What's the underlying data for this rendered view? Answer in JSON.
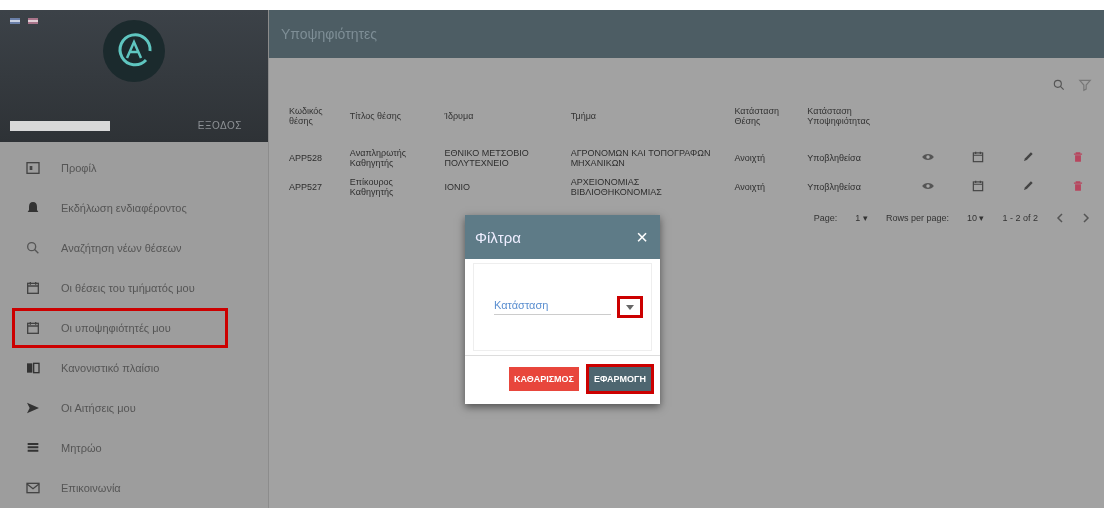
{
  "sidebar": {
    "logout": "ΕΞΟΔΟΣ",
    "items": [
      {
        "label": "Προφίλ",
        "highlighted": false
      },
      {
        "label": "Εκδήλωση ενδιαφέροντος",
        "highlighted": false
      },
      {
        "label": "Αναζήτηση νέων θέσεων",
        "highlighted": false
      },
      {
        "label": "Οι θέσεις του τμήματός μου",
        "highlighted": false
      },
      {
        "label": "Οι υποψηφιότητές μου",
        "highlighted": true
      },
      {
        "label": "Κανονιστικό πλαίσιο",
        "highlighted": false
      },
      {
        "label": "Οι Αιτήσεις μου",
        "highlighted": false
      },
      {
        "label": "Μητρώο",
        "highlighted": false
      },
      {
        "label": "Επικοινωνία",
        "highlighted": false
      }
    ]
  },
  "header": {
    "title": "Υποψηφιότητες"
  },
  "table": {
    "columns": [
      "Κωδικός θέσης",
      "Τίτλος θέσης",
      "Ίδρυμα",
      "Τμήμα",
      "Κατάσταση Θέσης",
      "Κατάσταση Υποψηφιότητας"
    ],
    "rows": [
      {
        "cells": [
          "APP528",
          "Αναπληρωτής Καθηγητής",
          "ΕΘΝΙΚΟ ΜΕΤΣΟΒΙΟ ΠΟΛΥΤΕΧΝΕΙΟ",
          "ΑΓΡΟΝΟΜΩΝ ΚΑΙ ΤΟΠΟΓΡΑΦΩΝ ΜΗΧΑΝΙΚΩΝ",
          "Ανοιχτή",
          "Υποβληθείσα"
        ]
      },
      {
        "cells": [
          "APP527",
          "Επίκουρος Καθηγητής",
          "ΙΟΝΙΟ",
          "ΑΡΧΕΙΟΝΟΜΙΑΣ ΒΙΒΛΙΟΘΗΚΟΝΟΜΙΑΣ",
          "Ανοιχτή",
          "Υποβληθείσα"
        ]
      }
    ]
  },
  "paginator": {
    "page_label": "Page:",
    "page": "1",
    "page_caret": "▾",
    "rows_label": "Rows per page:",
    "rows": "10",
    "rows_caret": "▾",
    "range": "1 - 2 of 2"
  },
  "dialog": {
    "title": "Φίλτρα",
    "close": "×",
    "select": {
      "placeholder": "Κατάσταση",
      "arrow_highlighted": true
    },
    "buttons": [
      {
        "label": "ΚΑΘΑΡΙΣΜΟΣ",
        "kind": "clear",
        "highlighted": false
      },
      {
        "label": "ΕΦΑΡΜΟΓΗ",
        "kind": "apply",
        "highlighted": true
      }
    ]
  }
}
